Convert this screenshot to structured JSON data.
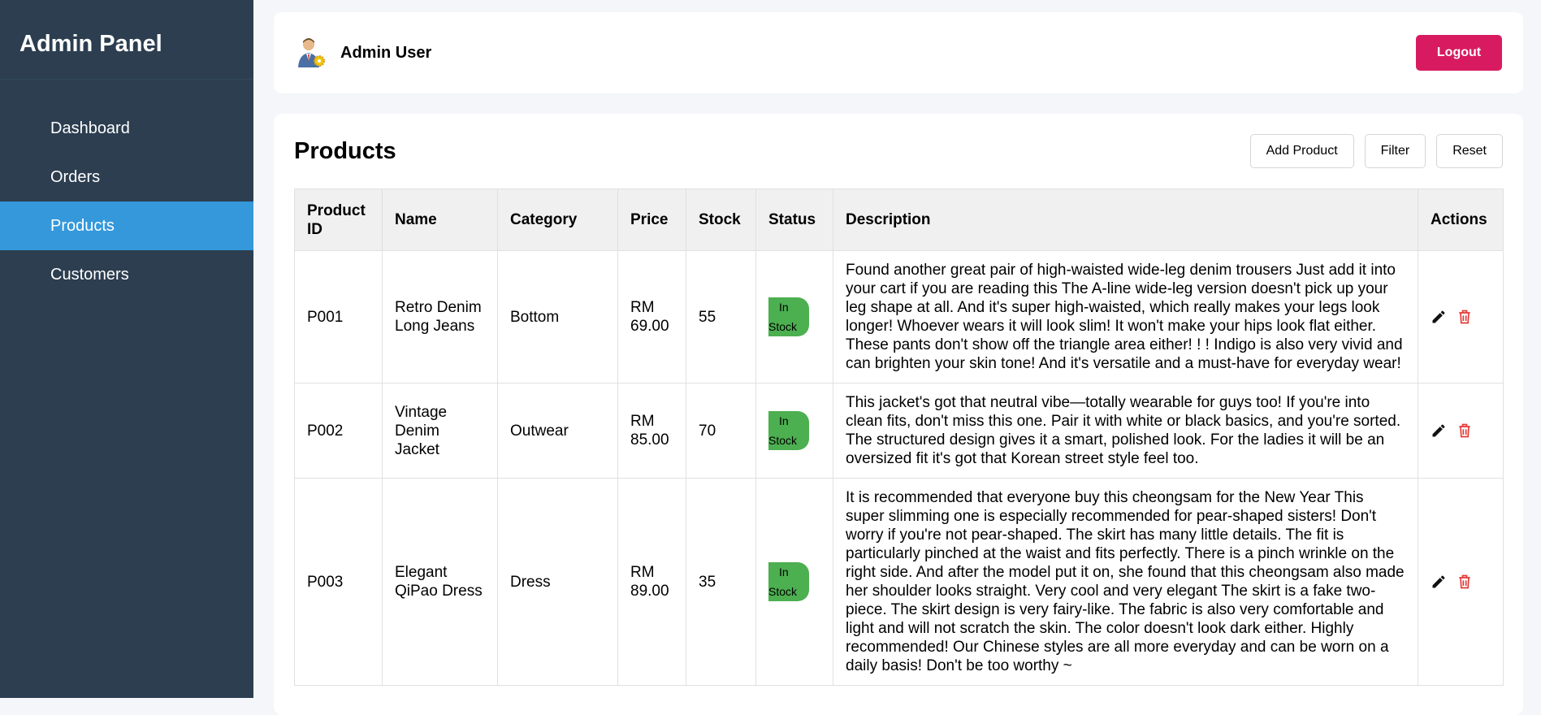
{
  "sidebar": {
    "title": "Admin Panel",
    "items": [
      {
        "label": "Dashboard",
        "active": false
      },
      {
        "label": "Orders",
        "active": false
      },
      {
        "label": "Products",
        "active": true
      },
      {
        "label": "Customers",
        "active": false
      }
    ]
  },
  "header": {
    "user_name": "Admin User",
    "logout_label": "Logout",
    "avatar_icon": "admin-user-icon"
  },
  "products": {
    "title": "Products",
    "buttons": {
      "add": "Add Product",
      "filter": "Filter",
      "reset": "Reset"
    },
    "columns": [
      "Product ID",
      "Name",
      "Category",
      "Price",
      "Stock",
      "Status",
      "Description",
      "Actions"
    ],
    "rows": [
      {
        "id": "P001",
        "name": "Retro Denim Long Jeans",
        "category": "Bottom",
        "price": "RM 69.00",
        "stock": "55",
        "status_1": "In",
        "status_2": "Stock",
        "description": "Found another great pair of high-waisted wide-leg denim trousers Just add it into your cart if you are reading this The A-line wide-leg version doesn't pick up your leg shape at all. And it's super high-waisted, which really makes your legs look longer! Whoever wears it will look slim! It won't make your hips look flat either. These pants don't show off the triangle area either! ! ! Indigo is also very vivid and can brighten your skin tone! And it's versatile and a must-have for everyday wear!"
      },
      {
        "id": "P002",
        "name": "Vintage Denim Jacket",
        "category": "Outwear",
        "price": "RM 85.00",
        "stock": "70",
        "status_1": "In",
        "status_2": "Stock",
        "description": "This jacket's got that neutral vibe—totally wearable for guys too! If you're into clean fits, don't miss this one. Pair it with white or black basics, and you're sorted. The structured design gives it a smart, polished look. For the ladies it will be an oversized fit it's got that Korean street style feel too."
      },
      {
        "id": "P003",
        "name": "Elegant QiPao Dress",
        "category": "Dress",
        "price": "RM 89.00",
        "stock": "35",
        "status_1": "In",
        "status_2": "Stock",
        "description": "It is recommended that everyone buy this cheongsam for the New Year This super slimming one is especially recommended for pear-shaped sisters! Don't worry if you're not pear-shaped. The skirt has many little details. The fit is particularly pinched at the waist and fits perfectly. There is a pinch wrinkle on the right side. And after the model put it on, she found that this cheongsam also made her shoulder looks straight. Very cool and very elegant The skirt is a fake two-piece. The skirt design is very fairy-like. The fabric is also very comfortable and light and will not scratch the skin. The color doesn't look dark either. Highly recommended! Our Chinese styles are all more everyday and can be worn on a daily basis! Don't be too worthy ~"
      }
    ],
    "action_icons": [
      "pencil-icon",
      "trash-icon"
    ],
    "colors": {
      "status": "#4caf50",
      "delete": "#e53935",
      "accent": "#3498db",
      "logout": "#d81b60"
    }
  }
}
